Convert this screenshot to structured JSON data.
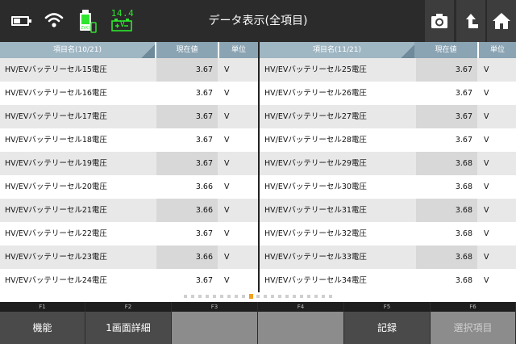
{
  "header": {
    "title": "データ表示(全項目)",
    "voltage": "14.4 V",
    "icons": {
      "battery": "battery-icon",
      "wifi": "wifi-icon",
      "vci": "zvci-icon",
      "car_battery": "car-battery-icon",
      "camera": "camera-icon",
      "back": "back-arrow-icon",
      "home": "home-icon"
    }
  },
  "left_table": {
    "headers": {
      "name": "項目名(10/21)",
      "value": "現在値",
      "unit": "単位"
    },
    "rows": [
      {
        "name": "HV/EVバッテリーセル15電圧",
        "value": "3.67",
        "unit": "V"
      },
      {
        "name": "HV/EVバッテリーセル16電圧",
        "value": "3.67",
        "unit": "V"
      },
      {
        "name": "HV/EVバッテリーセル17電圧",
        "value": "3.67",
        "unit": "V"
      },
      {
        "name": "HV/EVバッテリーセル18電圧",
        "value": "3.67",
        "unit": "V"
      },
      {
        "name": "HV/EVバッテリーセル19電圧",
        "value": "3.67",
        "unit": "V"
      },
      {
        "name": "HV/EVバッテリーセル20電圧",
        "value": "3.66",
        "unit": "V"
      },
      {
        "name": "HV/EVバッテリーセル21電圧",
        "value": "3.66",
        "unit": "V"
      },
      {
        "name": "HV/EVバッテリーセル22電圧",
        "value": "3.67",
        "unit": "V"
      },
      {
        "name": "HV/EVバッテリーセル23電圧",
        "value": "3.66",
        "unit": "V"
      },
      {
        "name": "HV/EVバッテリーセル24電圧",
        "value": "3.67",
        "unit": "V"
      }
    ]
  },
  "right_table": {
    "headers": {
      "name": "項目名(11/21)",
      "value": "現在値",
      "unit": "単位"
    },
    "rows": [
      {
        "name": "HV/EVバッテリーセル25電圧",
        "value": "3.67",
        "unit": "V"
      },
      {
        "name": "HV/EVバッテリーセル26電圧",
        "value": "3.67",
        "unit": "V"
      },
      {
        "name": "HV/EVバッテリーセル27電圧",
        "value": "3.67",
        "unit": "V"
      },
      {
        "name": "HV/EVバッテリーセル28電圧",
        "value": "3.67",
        "unit": "V"
      },
      {
        "name": "HV/EVバッテリーセル29電圧",
        "value": "3.68",
        "unit": "V"
      },
      {
        "name": "HV/EVバッテリーセル30電圧",
        "value": "3.68",
        "unit": "V"
      },
      {
        "name": "HV/EVバッテリーセル31電圧",
        "value": "3.68",
        "unit": "V"
      },
      {
        "name": "HV/EVバッテリーセル32電圧",
        "value": "3.68",
        "unit": "V"
      },
      {
        "name": "HV/EVバッテリーセル33電圧",
        "value": "3.68",
        "unit": "V"
      },
      {
        "name": "HV/EVバッテリーセル34電圧",
        "value": "3.68",
        "unit": "V"
      }
    ]
  },
  "pager": {
    "total": 21,
    "current": 10
  },
  "function_keys": [
    {
      "key": "F1",
      "label": "機能",
      "state": "active"
    },
    {
      "key": "F2",
      "label": "1画面詳細",
      "state": "active"
    },
    {
      "key": "F3",
      "label": "",
      "state": "blank"
    },
    {
      "key": "F4",
      "label": "",
      "state": "blank"
    },
    {
      "key": "F5",
      "label": "記録",
      "state": "active"
    },
    {
      "key": "F6",
      "label": "選択項目",
      "state": "disabled"
    }
  ],
  "colors": {
    "header_bg": "#2b2b2b",
    "voltage_green": "#2ee52e",
    "table_header": "#9fb6c3",
    "pager_active": "#f0a020"
  }
}
